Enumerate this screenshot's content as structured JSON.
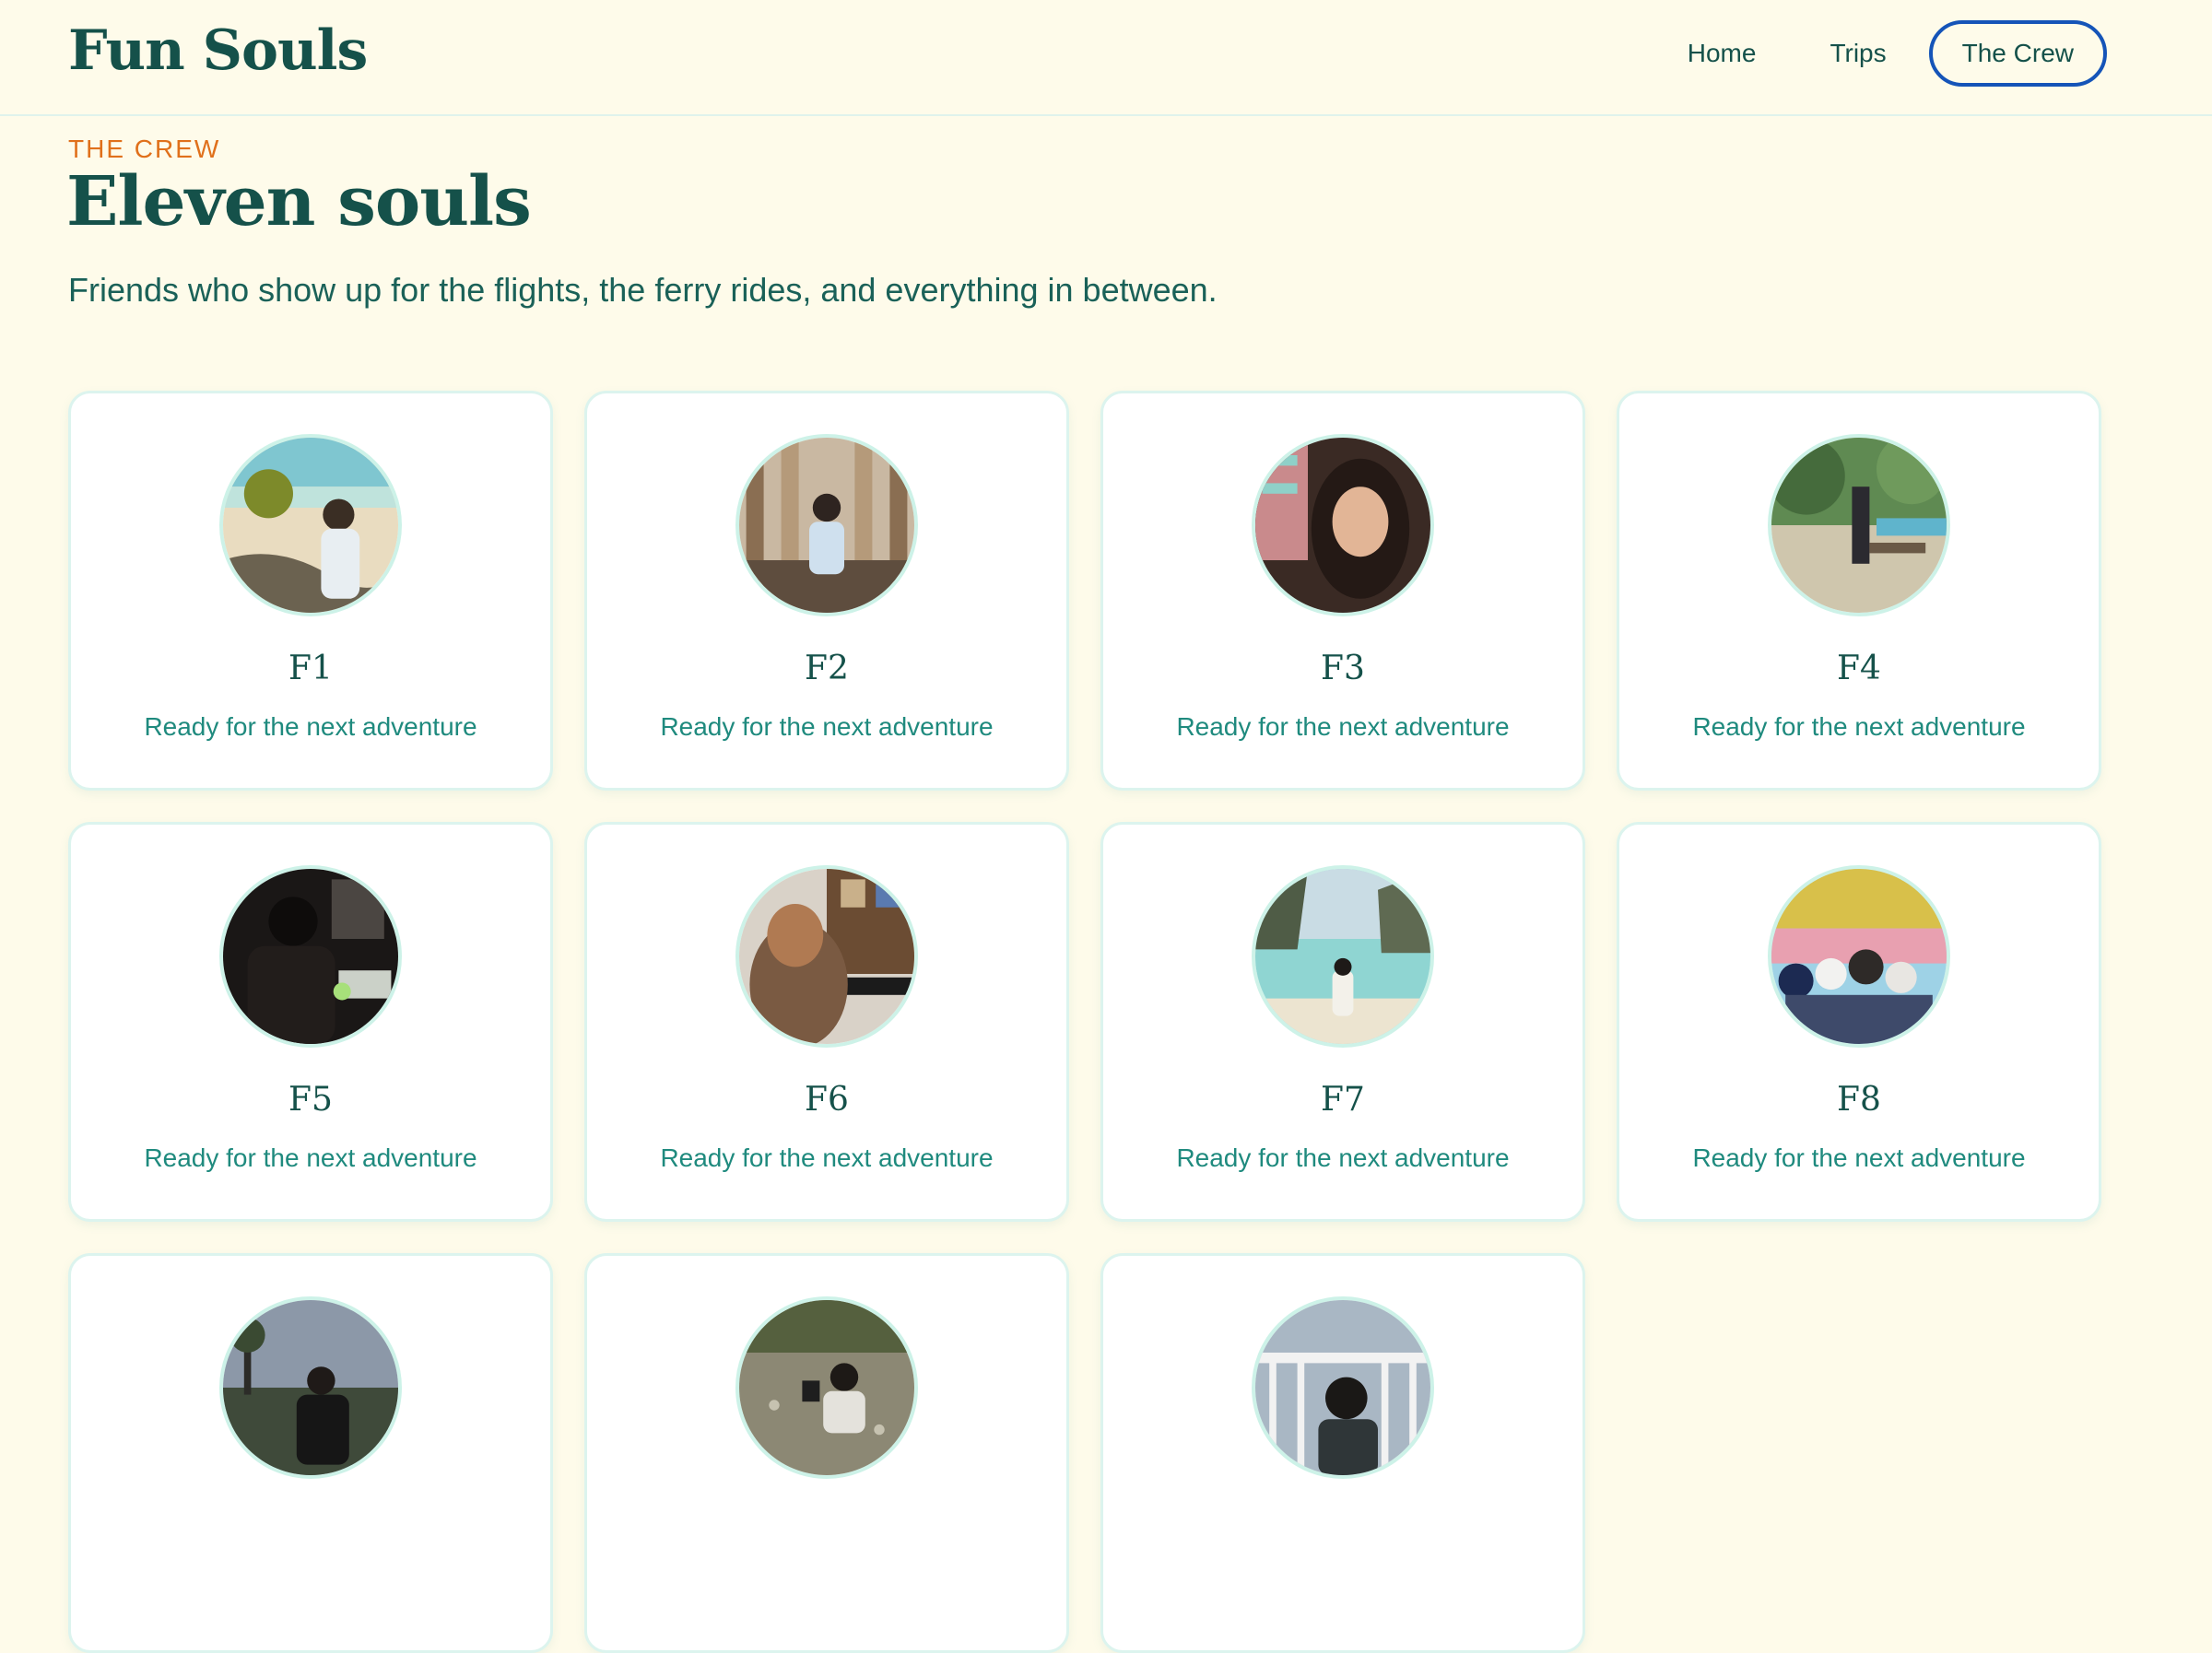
{
  "brand": "Fun Souls",
  "nav": {
    "home": "Home",
    "trips": "Trips",
    "crew": "The Crew"
  },
  "intro": {
    "eyebrow": "THE CREW",
    "title": "Eleven souls",
    "lead": "Friends who show up for the flights, the ferry rides, and everything in between."
  },
  "crew": [
    {
      "name": "F1",
      "tagline": "Ready for the next adventure",
      "photo": "beach-coconut"
    },
    {
      "name": "F2",
      "tagline": "Ready for the next adventure",
      "photo": "columns-building"
    },
    {
      "name": "F3",
      "tagline": "Ready for the next adventure",
      "photo": "selfie-evening"
    },
    {
      "name": "F4",
      "tagline": "Ready for the next adventure",
      "photo": "tree-seaside"
    },
    {
      "name": "F5",
      "tagline": "Ready for the next adventure",
      "photo": "cafe-dark"
    },
    {
      "name": "F6",
      "tagline": "Ready for the next adventure",
      "photo": "kitchen-cabinet"
    },
    {
      "name": "F7",
      "tagline": "Ready for the next adventure",
      "photo": "lagoon-cliffs"
    },
    {
      "name": "F8",
      "tagline": "Ready for the next adventure",
      "photo": "group-park"
    },
    {
      "name": "",
      "tagline": "",
      "photo": "sunset-palms"
    },
    {
      "name": "",
      "tagline": "",
      "photo": "sand-play"
    },
    {
      "name": "",
      "tagline": "",
      "photo": "balcony-railing"
    }
  ],
  "colors": {
    "background": "#fefbea",
    "brand": "#15514a",
    "accent": "#e0701b",
    "active_nav_border": "#1554b8",
    "tagline": "#1f8a7e",
    "card_border": "#dcf4ee"
  }
}
